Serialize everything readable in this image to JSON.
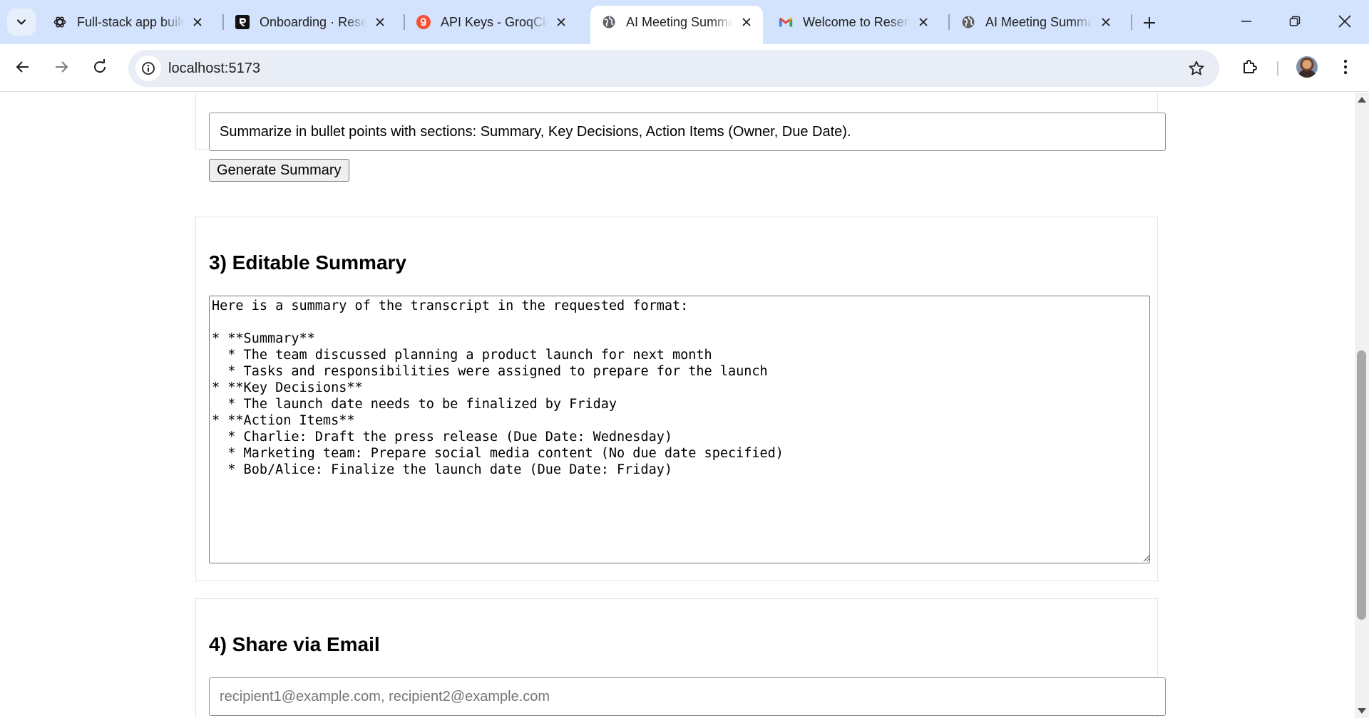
{
  "browser": {
    "tabs": [
      {
        "title": "Full-stack app build",
        "favicon": "openai-icon",
        "active": false
      },
      {
        "title": "Onboarding · Resend",
        "favicon": "resend-icon",
        "active": false
      },
      {
        "title": "API Keys - GroqCloud",
        "favicon": "groq-icon",
        "active": false
      },
      {
        "title": "AI Meeting Summarizer",
        "favicon": "globe-icon",
        "active": true
      },
      {
        "title": "Welcome to Resend",
        "favicon": "gmail-icon",
        "active": false
      },
      {
        "title": "AI Meeting Summarizer",
        "favicon": "globe-icon",
        "active": false
      }
    ],
    "address": {
      "url": "localhost:5173"
    }
  },
  "page": {
    "prompt_input": {
      "value": "Summarize in bullet points with sections: Summary, Key Decisions, Action Items (Owner, Due Date)."
    },
    "generate_button": {
      "label": "Generate Summary"
    },
    "summary_section": {
      "title": "3) Editable Summary",
      "text": "Here is a summary of the transcript in the requested format:\n\n* **Summary**\n  * The team discussed planning a product launch for next month\n  * Tasks and responsibilities were assigned to prepare for the launch\n* **Key Decisions**\n  * The launch date needs to be finalized by Friday\n* **Action Items**\n  * Charlie: Draft the press release (Due Date: Wednesday)\n  * Marketing team: Prepare social media content (No due date specified)\n  * Bob/Alice: Finalize the launch date (Due Date: Friday)"
    },
    "email_section": {
      "title": "4) Share via Email",
      "recipients_placeholder": "recipient1@example.com, recipient2@example.com"
    }
  },
  "colors": {
    "tabstrip_bg": "#d3e3fd",
    "omnibox_bg": "#e9eef6",
    "groq_orange": "#f55036",
    "gmail_red": "#ea4335"
  }
}
